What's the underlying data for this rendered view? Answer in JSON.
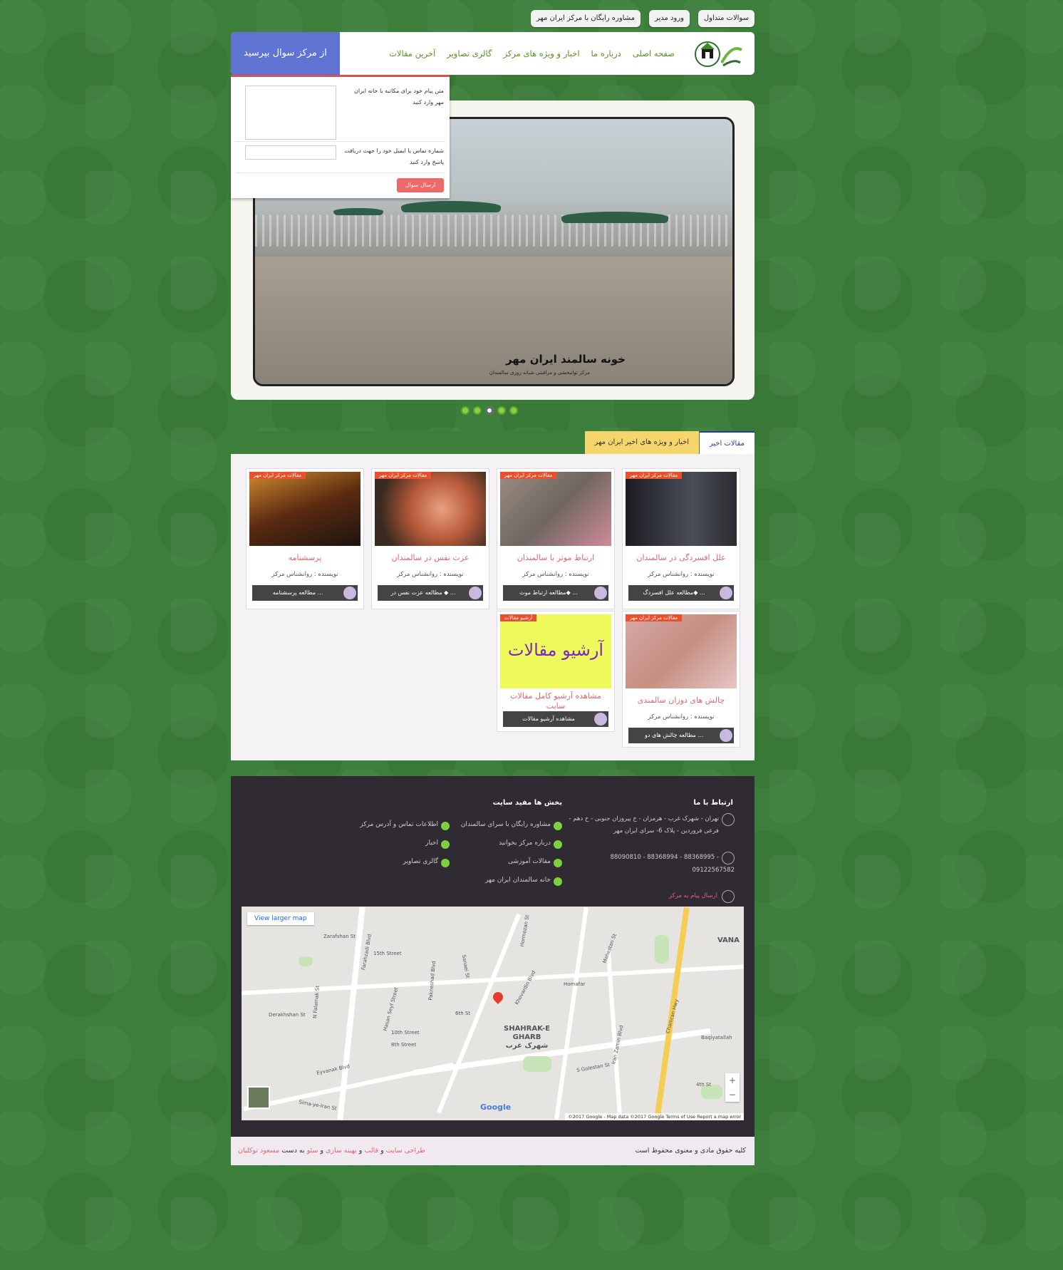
{
  "top_links": [
    "سوالات متداول",
    "ورود مدیر",
    "مشاوره رایگان با مرکز ایران مهر"
  ],
  "header": {
    "ask_button": "از مرکز سوال بپرسید",
    "nav": [
      "صفحه اصلی",
      "درباره ما",
      "اخبار و ویژه های مرکز",
      "گالری تصاویر",
      "آخرین مقالات"
    ]
  },
  "popup": {
    "message_label": "متن پیام خود برای مکاتبه با خانه ایران مهر وارد کنید",
    "contact_label": "شماره تماس یا ایمیل خود را جهت دریافت پاسخ وارد کنید",
    "send_label": "ارسال سوال"
  },
  "slider": {
    "caption": "خونه سالمند ایران مهر",
    "caption_sub": "مرکز توانبخشی و مراقبتی شبانه روزی سالمندان",
    "active_dot": 3,
    "dot_count": 5
  },
  "tabs": [
    "مقالات اخیر",
    "اخبار و ویژه های اخیر ایران مهر"
  ],
  "articles": {
    "badge": "مقالات مرکز ایران مهر",
    "author_line": "نویسنده : روانشناس مرکز",
    "cards": [
      {
        "title": "علل افسردگی در سالمندان",
        "more": "مطالعه علل افسردگ◆ ..."
      },
      {
        "title": "ارتباط موثر با سالمندان",
        "more": "مطالعه ارتباط موث◆ ..."
      },
      {
        "title": "عزت نفس در سالمندان",
        "more": "مطالعه عزت نفس در ◆ ..."
      },
      {
        "title": "پرسشنامه",
        "more": "مطالعه پرسشنامه ..."
      },
      {
        "title": "چالش های دوران سالمندی",
        "more": "مطالعه چالش های دو ..."
      }
    ],
    "archive": {
      "badge": "آرشیو مقالات",
      "image_text": "آرشیو مقالات",
      "title": "مشاهده آرشیو کامل مقالات سایت",
      "more": "مشاهده آرشیو مقالات"
    }
  },
  "footer": {
    "contact_heading": "ارتباط با ما",
    "address": "تهران - شهرک غرب - هرمزان - خ پیروزان جنوبی - خ دهم - فرعی فروردین - پلاک 6- سرای ایران مهر",
    "phones": "88090810  -  88368994  -  88368995  -",
    "mobile": "09122567582",
    "send_message": "ارسال پیام به مرکز",
    "links_heading": "بخش ها مفید سایت",
    "links_col1": [
      "مشاوره رایگان با سرای سالمندان",
      "درباره مرکز بخوانید",
      "مقالات آموزشی",
      "خانه سالمندان ایران مهر"
    ],
    "links_col2": [
      "اطلاعات تماس و آدرس مرکز",
      "اخبار",
      "گالری تصاویر"
    ]
  },
  "map": {
    "larger_map": "View larger map",
    "district": "SHAHRAK-E\nGHARB\nشهرک غرب",
    "attribution": "©2017 Google - Map data ©2017 Google    Terms of Use    Report a map error",
    "google": "Google",
    "labels": [
      "Zarafshan St",
      "Farahzadi Blvd",
      "Hasan Seyf Street",
      "Pakneshad Blvd",
      "Sanaei St",
      "Hormozan St",
      "Khovardin Blvd",
      "Mahestan St",
      "Iran Zamin Blvd",
      "Chamran Hwy",
      "Baqiyatallah",
      "Eyvanak Blvd",
      "Sima-ye-Iran St",
      "S Golestan St",
      "Derakhshan St",
      "N Falamak St",
      "4th St",
      "6th St",
      "10th Street",
      "8th Street",
      "15th Street",
      "Homafar",
      "VANA"
    ]
  },
  "copyright": {
    "right": "کلیه حقوق مادی و معنوی محفوظ است",
    "design": "طراحی سایت",
    "and1": "و",
    "template": "قالب",
    "and2": "و",
    "seo1": "بهینه سازی",
    "and3": "و",
    "seo2": "سئو",
    "by": "به دست",
    "author": "مسعود توکلیان"
  }
}
